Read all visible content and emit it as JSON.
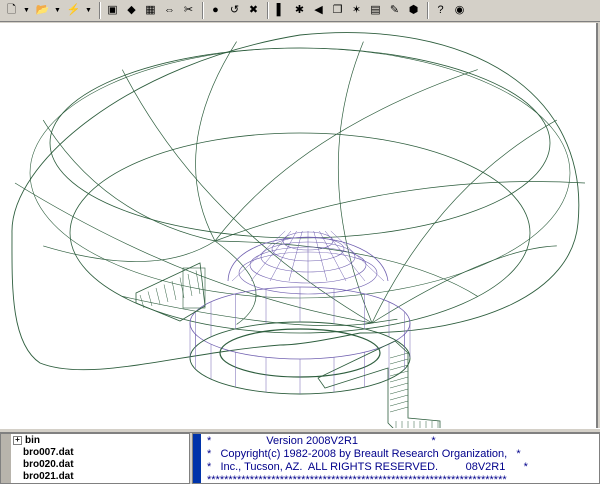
{
  "toolbar": {
    "buttons": [
      {
        "name": "new-file-icon",
        "glyph": "🗋",
        "dropdown": true
      },
      {
        "name": "open-folder-icon",
        "glyph": "📂",
        "dropdown": true
      },
      {
        "name": "lightning-icon",
        "glyph": "⚡",
        "dropdown": true
      },
      {
        "name": "display-icon",
        "glyph": "▣"
      },
      {
        "name": "ray-trace-icon",
        "glyph": "◆"
      },
      {
        "name": "grid-icon",
        "glyph": "▦"
      },
      {
        "name": "split-icon",
        "glyph": "⇔"
      },
      {
        "name": "scissors-icon",
        "glyph": "✂"
      },
      {
        "name": "stop-icon",
        "glyph": "●"
      },
      {
        "name": "undo-icon",
        "glyph": "↺"
      },
      {
        "name": "delete-icon",
        "glyph": "✖"
      },
      {
        "name": "color-bars-icon",
        "glyph": "▌"
      },
      {
        "name": "scatter-icon",
        "glyph": "✱"
      },
      {
        "name": "rewind-icon",
        "glyph": "◀"
      },
      {
        "name": "copy-icon",
        "glyph": "❐"
      },
      {
        "name": "wand-icon",
        "glyph": "✶"
      },
      {
        "name": "table-icon",
        "glyph": "▤"
      },
      {
        "name": "ruler-icon",
        "glyph": "✎"
      },
      {
        "name": "cube-icon",
        "glyph": "⬢"
      },
      {
        "name": "help-icon",
        "glyph": "?"
      },
      {
        "name": "globe-icon",
        "glyph": "◉"
      }
    ]
  },
  "tree": {
    "items": [
      {
        "label": "bin",
        "expander": "+"
      },
      {
        "label": "bro007.dat"
      },
      {
        "label": "bro020.dat"
      },
      {
        "label": "bro021.dat"
      }
    ]
  },
  "console": {
    "lines": [
      "*                  Version 2008V2R1                        *",
      "*   Copyright(c) 1982-2008 by Breault Research Organization,   *",
      "*   Inc., Tucson, AZ.  ALL RIGHTS RESERVED.         08V2R1      *",
      "**********************************************************************"
    ]
  },
  "colors": {
    "wire_green": "#2e5e3e",
    "wire_purple": "#7060b0",
    "console_text": "#00008b"
  }
}
